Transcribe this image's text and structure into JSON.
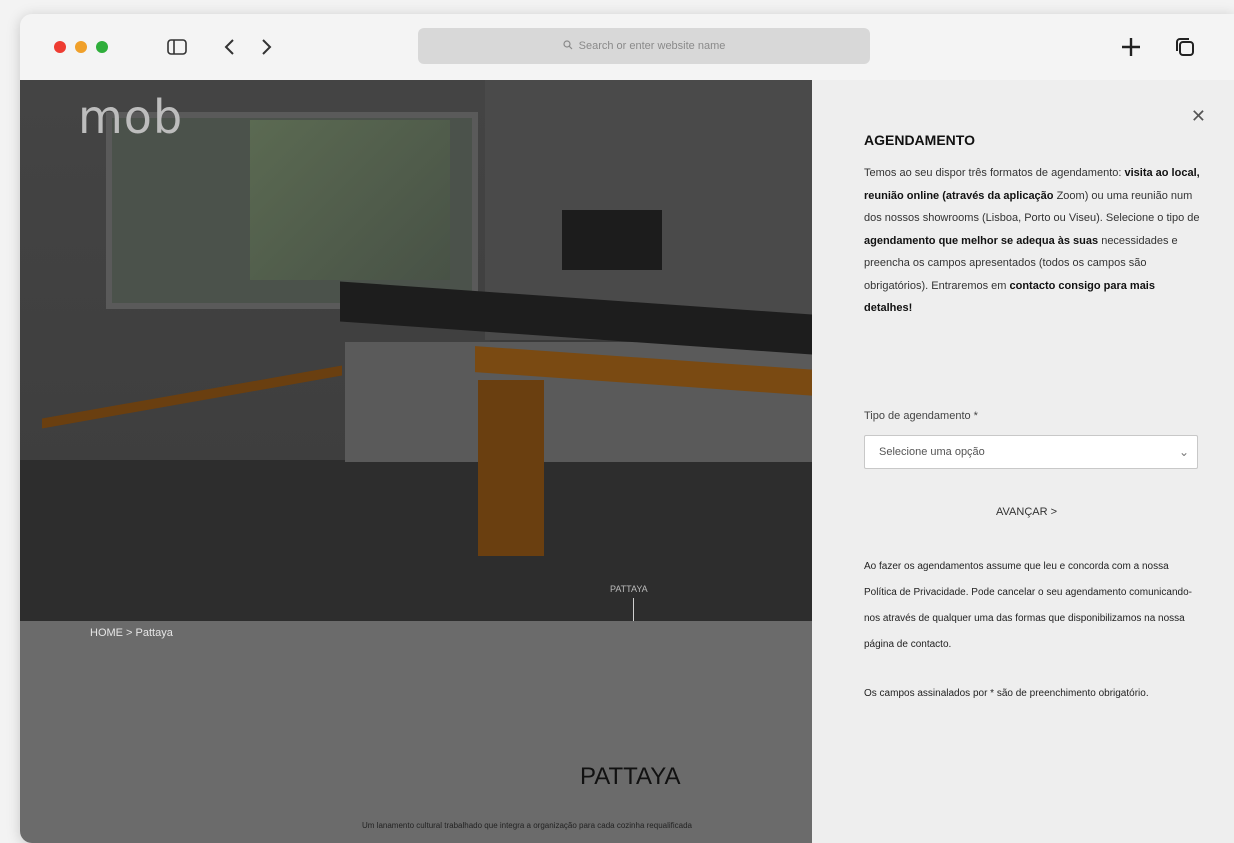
{
  "browser": {
    "address_placeholder": "Search or enter website name"
  },
  "site": {
    "logo": "mob",
    "hero_tag": "PATTAYA",
    "breadcrumb": "HOME > Pattaya",
    "title": "PATTAYA",
    "intro": "Um lanamento cultural trabalhado que integra a organização para cada cozinha requalificada"
  },
  "modal": {
    "title": "AGENDAMENTO",
    "description_pre": "Temos ao seu dispor três formatos de agendamento: ",
    "description_bold1": "visita ao local, reunião online (através da aplicação",
    "description_mid": " Zoom) ou uma reunião num dos nossos showrooms (Lisboa, Porto ou Viseu). Selecione o tipo de ",
    "description_bold2": "agendamento que melhor se adequa às suas",
    "description_post": " necessidades e preencha os campos apresentados (todos os campos são obrigatórios). Entraremos em ",
    "description_bold3": "contacto consigo para mais detalhes!",
    "field_label": "Tipo de agendamento *",
    "select_value": "Selecione uma opção",
    "next_label": "AVANÇAR",
    "legal_text": "Ao fazer os agendamentos assume que leu e concorda com a nossa Política de Privacidade. Pode cancelar o seu agendamento comunicando-nos através de qualquer uma das formas que disponibilizamos na nossa página de contacto.",
    "required_note": "Os campos assinalados por * são de preenchimento obrigatório."
  },
  "colors": {
    "traffic_red": "#ee3c32",
    "traffic_yellow": "#f0a02a",
    "traffic_green": "#2fae3b",
    "panel_bg": "#eeeeee",
    "overlay": "#6b6b6b"
  },
  "icons": [
    "sidebar-icon",
    "chevron-left-icon",
    "chevron-right-icon",
    "search-icon",
    "plus-icon",
    "tabs-icon",
    "close-icon",
    "chevron-down-icon"
  ]
}
